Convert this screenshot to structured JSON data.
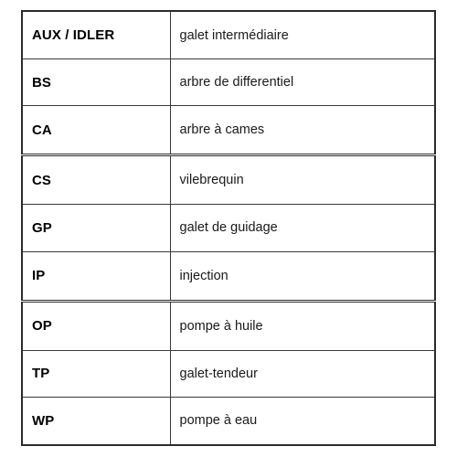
{
  "document": {
    "kind": "glossary-table",
    "language": "fr",
    "background_color": "#ffffff",
    "border_color": "#2b2b2b",
    "text_color": "#000000"
  },
  "table": {
    "column_count": 2,
    "row_count": 9,
    "group_separator_after_rows": [
      3,
      6
    ],
    "rows": [
      {
        "code": "AUX / IDLER",
        "label": "galet intermédiaire"
      },
      {
        "code": "BS",
        "label": "arbre de differentiel"
      },
      {
        "code": "CA",
        "label": "arbre à cames"
      },
      {
        "code": "CS",
        "label": "vilebrequin"
      },
      {
        "code": "GP",
        "label": "galet de guidage"
      },
      {
        "code": "IP",
        "label": "injection"
      },
      {
        "code": "OP",
        "label": "pompe à huile"
      },
      {
        "code": "TP",
        "label": "galet-tendeur"
      },
      {
        "code": "WP",
        "label": "pompe à eau"
      }
    ]
  }
}
